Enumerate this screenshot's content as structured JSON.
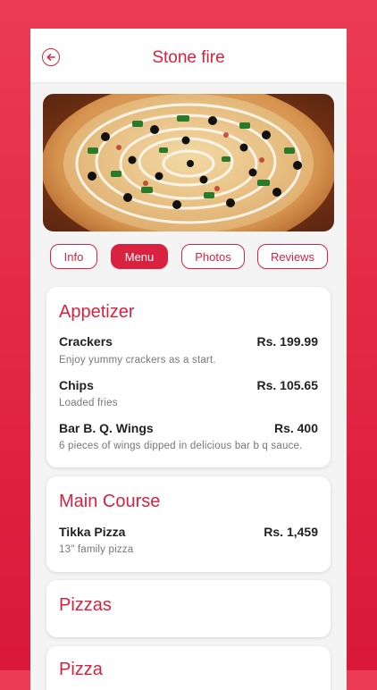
{
  "header": {
    "title": "Stone fire",
    "back_icon": "arrow-left-circle-icon"
  },
  "hero": {
    "image": "pizza-photo"
  },
  "tabs": [
    {
      "label": "Info",
      "active": false
    },
    {
      "label": "Menu",
      "active": true
    },
    {
      "label": "Photos",
      "active": false
    },
    {
      "label": "Reviews",
      "active": false
    }
  ],
  "sections": [
    {
      "title": "Appetizer",
      "items": [
        {
          "name": "Crackers",
          "price": "Rs. 199.99",
          "desc": "Enjoy yummy crackers as a start."
        },
        {
          "name": "Chips",
          "price": "Rs. 105.65",
          "desc": "Loaded fries"
        },
        {
          "name": "Bar B. Q. Wings",
          "price": "Rs. 400",
          "desc": "6 pieces of wings dipped in delicious bar b q sauce."
        }
      ]
    },
    {
      "title": "Main Course",
      "items": [
        {
          "name": "Tikka Pizza",
          "price": "Rs. 1,459",
          "desc": "13\" family pizza"
        }
      ]
    },
    {
      "title": "Pizzas",
      "items": []
    },
    {
      "title": "Pizza",
      "items": []
    }
  ],
  "colors": {
    "accent": "#d8223f",
    "background": "#e32a44"
  }
}
